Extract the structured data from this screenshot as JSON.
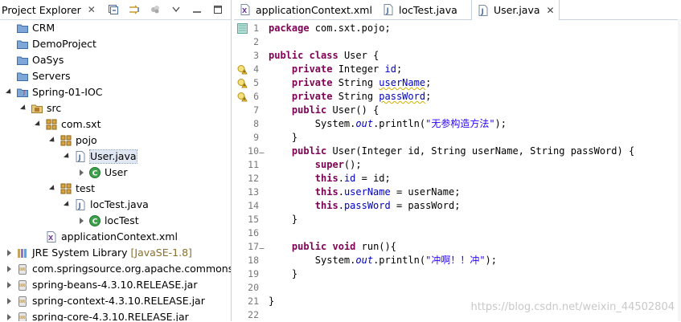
{
  "project_explorer": {
    "title": "Project Explorer",
    "close": "✕",
    "tree": [
      {
        "label": "CRM",
        "icon": "folder-icon",
        "expanded": null
      },
      {
        "label": "DemoProject",
        "icon": "folder-icon",
        "expanded": null
      },
      {
        "label": "OaSys",
        "icon": "folder-icon",
        "expanded": null
      },
      {
        "label": "Servers",
        "icon": "folder-icon",
        "expanded": null
      },
      {
        "label": "Spring-01-IOC",
        "icon": "java-project-icon",
        "expanded": true
      },
      {
        "label": "src",
        "icon": "source-folder-icon",
        "expanded": true
      },
      {
        "label": "com.sxt",
        "icon": "package-icon",
        "expanded": true
      },
      {
        "label": "pojo",
        "icon": "package-icon",
        "expanded": true
      },
      {
        "label": "User.java",
        "icon": "java-file-icon",
        "expanded": true,
        "selected": true
      },
      {
        "label": "User",
        "icon": "class-icon",
        "expanded": false
      },
      {
        "label": "test",
        "icon": "package-icon",
        "expanded": true
      },
      {
        "label": "locTest.java",
        "icon": "java-file-icon",
        "expanded": true
      },
      {
        "label": "locTest",
        "icon": "class-icon",
        "expanded": false
      },
      {
        "label": "applicationContext.xml",
        "icon": "xml-file-icon",
        "expanded": null
      },
      {
        "label": "JRE System Library",
        "decoration": "[JavaSE-1.8]",
        "icon": "library-icon",
        "expanded": false
      },
      {
        "label": "com.springsource.org.apache.commons.lo",
        "icon": "jar-icon",
        "expanded": false
      },
      {
        "label": "spring-beans-4.3.10.RELEASE.jar",
        "icon": "jar-icon",
        "expanded": false
      },
      {
        "label": "spring-context-4.3.10.RELEASE.jar",
        "icon": "jar-icon",
        "expanded": false
      },
      {
        "label": "spring-core-4.3.10.RELEASE.jar",
        "icon": "jar-icon",
        "expanded": false
      }
    ]
  },
  "editor": {
    "tabs": [
      {
        "label": "applicationContext.xml",
        "icon": "xml-file-icon",
        "active": false
      },
      {
        "label": "locTest.java",
        "icon": "java-file-icon",
        "active": false
      },
      {
        "label": "User.java",
        "icon": "java-file-icon",
        "active": true,
        "close": "✕"
      }
    ],
    "lines": [
      {
        "num": "1",
        "marker": "bookmark",
        "code": [
          [
            "kw",
            "package"
          ],
          [
            "t",
            " com.sxt.pojo;"
          ]
        ]
      },
      {
        "num": "2",
        "code": []
      },
      {
        "num": "3",
        "code": [
          [
            "kw",
            "public"
          ],
          [
            "t",
            " "
          ],
          [
            "kw",
            "class"
          ],
          [
            "t",
            " User {"
          ]
        ]
      },
      {
        "num": "4",
        "marker": "warning",
        "code": [
          [
            "t",
            "    "
          ],
          [
            "kw",
            "private"
          ],
          [
            "t",
            " Integer "
          ],
          [
            "fld",
            "id"
          ],
          [
            "t",
            ";"
          ]
        ]
      },
      {
        "num": "5",
        "marker": "warning",
        "code": [
          [
            "t",
            "    "
          ],
          [
            "kw",
            "private"
          ],
          [
            "t",
            " String "
          ],
          [
            "fldw",
            "userName"
          ],
          [
            "t",
            ";"
          ]
        ]
      },
      {
        "num": "6",
        "marker": "warning",
        "code": [
          [
            "t",
            "    "
          ],
          [
            "kw",
            "private"
          ],
          [
            "t",
            " String "
          ],
          [
            "fldw",
            "passWord"
          ],
          [
            "t",
            ";"
          ]
        ]
      },
      {
        "num": "7",
        "code": [
          [
            "t",
            "    "
          ],
          [
            "kw",
            "public"
          ],
          [
            "t",
            " User() {"
          ]
        ]
      },
      {
        "num": "8",
        "code": [
          [
            "t",
            "        System."
          ],
          [
            "sfld",
            "out"
          ],
          [
            "t",
            ".println("
          ],
          [
            "str",
            "\"无参构造方法\""
          ],
          [
            "t",
            ");"
          ]
        ]
      },
      {
        "num": "9",
        "code": [
          [
            "t",
            "    }"
          ]
        ]
      },
      {
        "num": "10",
        "fold": true,
        "code": [
          [
            "t",
            "    "
          ],
          [
            "kw",
            "public"
          ],
          [
            "t",
            " User(Integer id, String userName, String passWord) {"
          ]
        ]
      },
      {
        "num": "11",
        "code": [
          [
            "t",
            "        "
          ],
          [
            "kw",
            "super"
          ],
          [
            "t",
            "();"
          ]
        ]
      },
      {
        "num": "12",
        "code": [
          [
            "t",
            "        "
          ],
          [
            "kw",
            "this"
          ],
          [
            "t",
            "."
          ],
          [
            "fld",
            "id"
          ],
          [
            "t",
            " = id;"
          ]
        ]
      },
      {
        "num": "13",
        "code": [
          [
            "t",
            "        "
          ],
          [
            "kw",
            "this"
          ],
          [
            "t",
            "."
          ],
          [
            "fld",
            "userName"
          ],
          [
            "t",
            " = userName;"
          ]
        ]
      },
      {
        "num": "14",
        "code": [
          [
            "t",
            "        "
          ],
          [
            "kw",
            "this"
          ],
          [
            "t",
            "."
          ],
          [
            "fld",
            "passWord"
          ],
          [
            "t",
            " = passWord;"
          ]
        ]
      },
      {
        "num": "15",
        "code": [
          [
            "t",
            "    }"
          ]
        ]
      },
      {
        "num": "16",
        "code": []
      },
      {
        "num": "17",
        "fold": true,
        "code": [
          [
            "t",
            "    "
          ],
          [
            "kw",
            "public"
          ],
          [
            "t",
            " "
          ],
          [
            "kw",
            "void"
          ],
          [
            "t",
            " run(){"
          ]
        ]
      },
      {
        "num": "18",
        "code": [
          [
            "t",
            "        System."
          ],
          [
            "sfld",
            "out"
          ],
          [
            "t",
            ".println("
          ],
          [
            "str",
            "\"冲啊！！冲\""
          ],
          [
            "t",
            ");"
          ]
        ]
      },
      {
        "num": "19",
        "code": [
          [
            "t",
            "    }"
          ]
        ]
      },
      {
        "num": "20",
        "code": []
      },
      {
        "num": "21",
        "code": [
          [
            "t",
            "}"
          ]
        ]
      },
      {
        "num": "22",
        "code": []
      }
    ],
    "watermark": "https://blog.csdn.net/weixin_44502804"
  },
  "colors": {
    "keyword": "#7f0055",
    "field": "#0000c0",
    "string": "#2a00ff",
    "line_number": "#787878",
    "selection": "#e1e7f2"
  }
}
